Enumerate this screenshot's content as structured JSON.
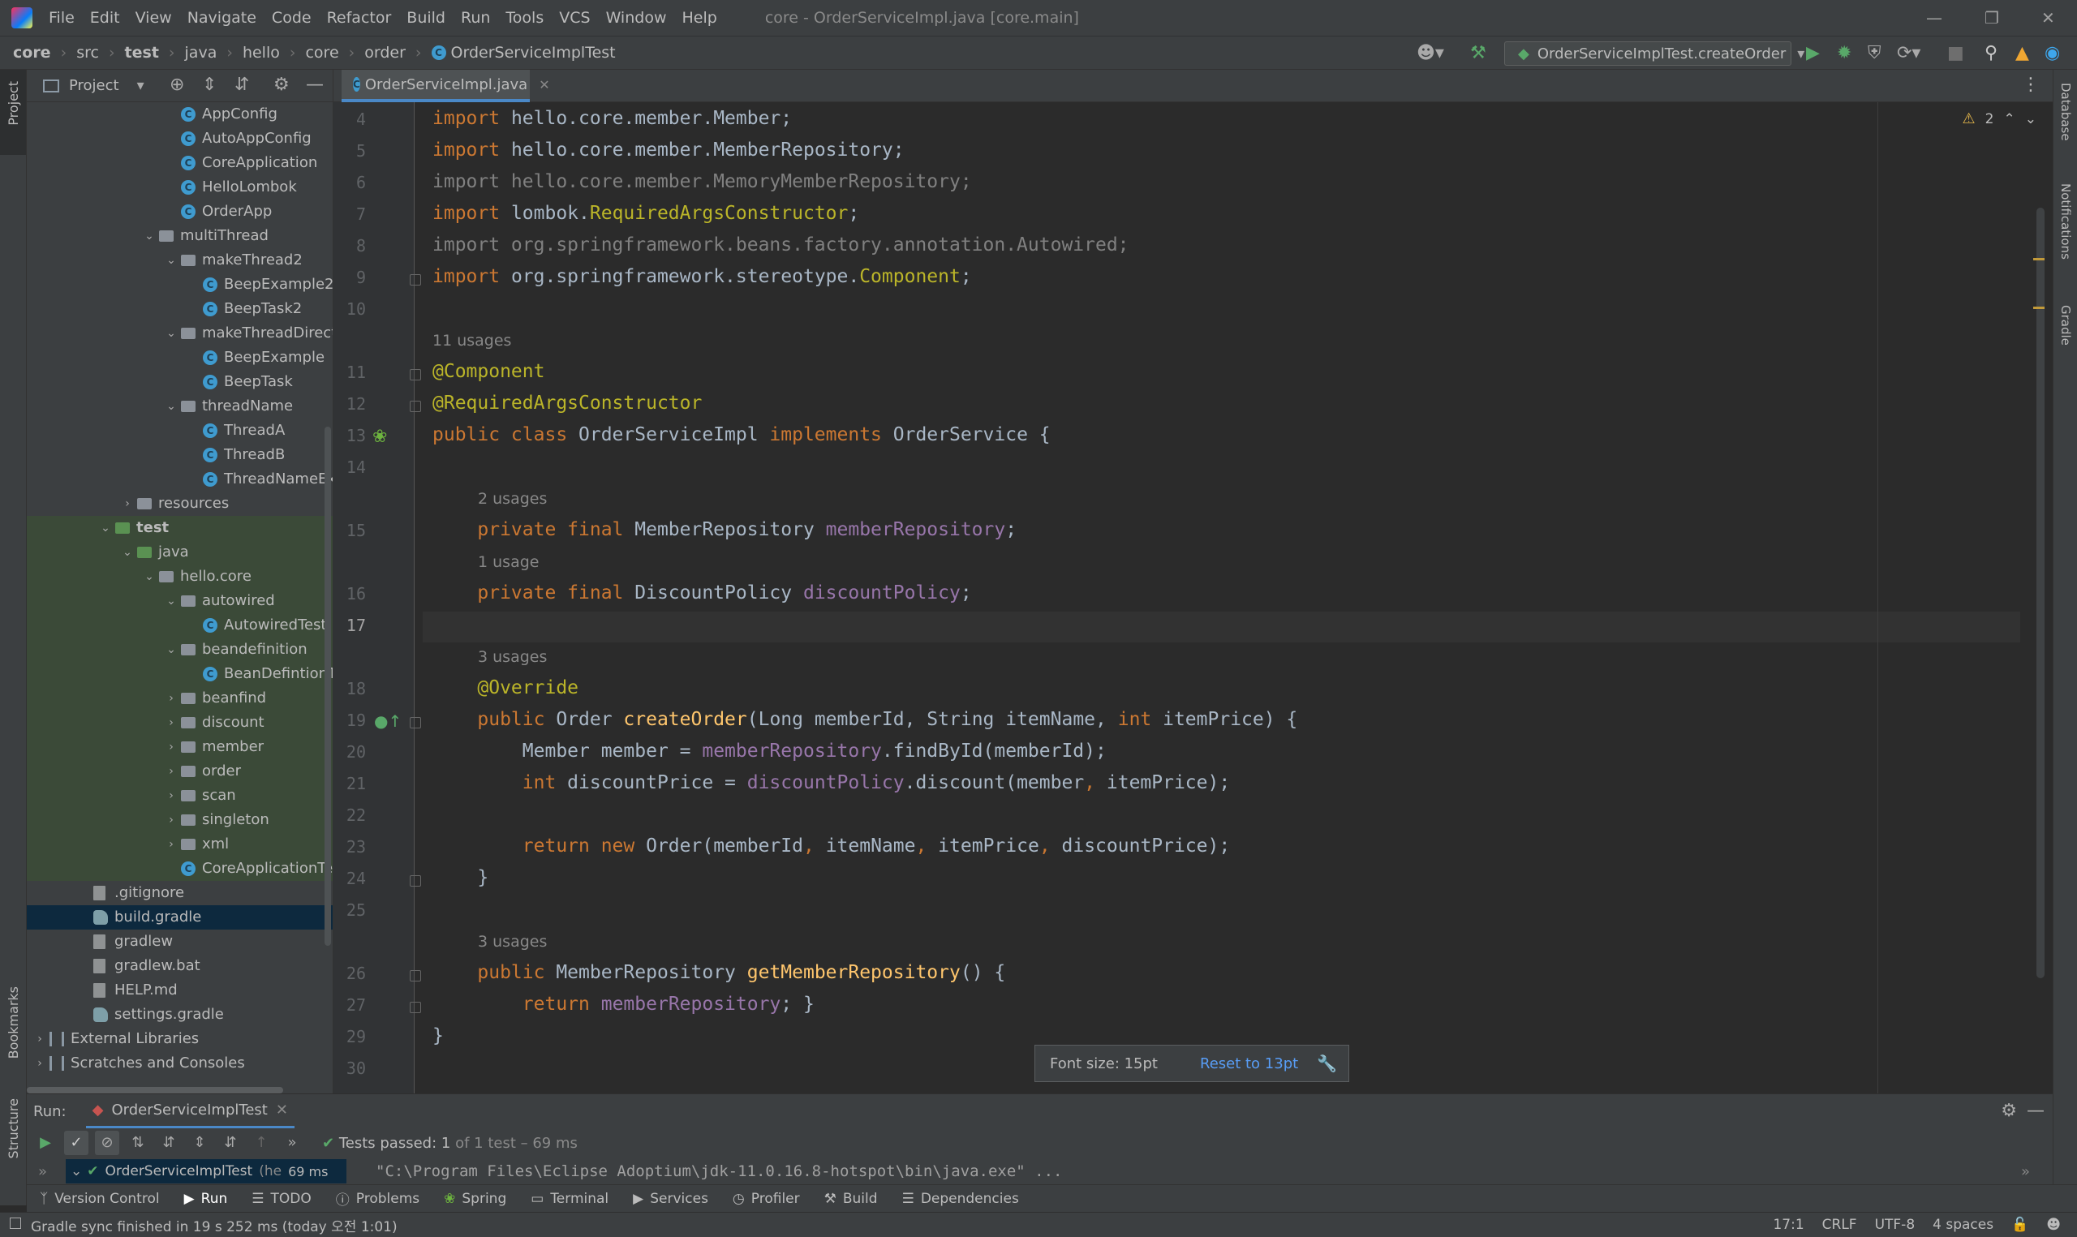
{
  "menubar": {
    "items": [
      "File",
      "Edit",
      "View",
      "Navigate",
      "Code",
      "Refactor",
      "Build",
      "Run",
      "Tools",
      "VCS",
      "Window",
      "Help"
    ],
    "window_title": "core - OrderServiceImpl.java [core.main]"
  },
  "breadcrumb": [
    "core",
    "src",
    "test",
    "java",
    "hello",
    "core",
    "order",
    "OrderServiceImplTest"
  ],
  "run_config": {
    "label": "OrderServiceImplTest.createOrder"
  },
  "project_panel": {
    "title": "Project"
  },
  "tree": [
    {
      "label": "AppConfig",
      "indent": 6,
      "icon": "cls"
    },
    {
      "label": "AutoAppConfig",
      "indent": 6,
      "icon": "cls"
    },
    {
      "label": "CoreApplication",
      "indent": 6,
      "icon": "cls"
    },
    {
      "label": "HelloLombok",
      "indent": 6,
      "icon": "cls"
    },
    {
      "label": "OrderApp",
      "indent": 6,
      "icon": "cls"
    },
    {
      "label": "multiThread",
      "indent": 5,
      "icon": "folder",
      "chev": "open"
    },
    {
      "label": "makeThread2",
      "indent": 6,
      "icon": "folder",
      "chev": "open"
    },
    {
      "label": "BeepExample2",
      "indent": 7,
      "icon": "cls"
    },
    {
      "label": "BeepTask2",
      "indent": 7,
      "icon": "cls"
    },
    {
      "label": "makeThreadDirectly",
      "indent": 6,
      "icon": "folder",
      "chev": "open"
    },
    {
      "label": "BeepExample",
      "indent": 7,
      "icon": "cls"
    },
    {
      "label": "BeepTask",
      "indent": 7,
      "icon": "cls"
    },
    {
      "label": "threadName",
      "indent": 6,
      "icon": "folder",
      "chev": "open"
    },
    {
      "label": "ThreadA",
      "indent": 7,
      "icon": "cls"
    },
    {
      "label": "ThreadB",
      "indent": 7,
      "icon": "cls"
    },
    {
      "label": "ThreadNameExam",
      "indent": 7,
      "icon": "cls"
    },
    {
      "label": "resources",
      "indent": 4,
      "icon": "folder-res",
      "chev": "closed"
    },
    {
      "label": "test",
      "indent": 3,
      "icon": "folder-green",
      "chev": "open",
      "bold": true,
      "green": true
    },
    {
      "label": "java",
      "indent": 4,
      "icon": "folder-green",
      "chev": "open",
      "green": true
    },
    {
      "label": "hello.core",
      "indent": 5,
      "icon": "folder",
      "chev": "open",
      "green": true
    },
    {
      "label": "autowired",
      "indent": 6,
      "icon": "folder",
      "chev": "open",
      "green": true
    },
    {
      "label": "AutowiredTest",
      "indent": 7,
      "icon": "cls",
      "green": true
    },
    {
      "label": "beandefinition",
      "indent": 6,
      "icon": "folder",
      "chev": "open",
      "green": true
    },
    {
      "label": "BeanDefintionTest",
      "indent": 7,
      "icon": "cls",
      "green": true
    },
    {
      "label": "beanfind",
      "indent": 6,
      "icon": "folder",
      "chev": "closed",
      "green": true
    },
    {
      "label": "discount",
      "indent": 6,
      "icon": "folder",
      "chev": "closed",
      "green": true
    },
    {
      "label": "member",
      "indent": 6,
      "icon": "folder",
      "chev": "closed",
      "green": true
    },
    {
      "label": "order",
      "indent": 6,
      "icon": "folder",
      "chev": "closed",
      "green": true
    },
    {
      "label": "scan",
      "indent": 6,
      "icon": "folder",
      "chev": "closed",
      "green": true
    },
    {
      "label": "singleton",
      "indent": 6,
      "icon": "folder",
      "chev": "closed",
      "green": true
    },
    {
      "label": "xml",
      "indent": 6,
      "icon": "folder",
      "chev": "closed",
      "green": true
    },
    {
      "label": "CoreApplicationTests",
      "indent": 6,
      "icon": "cls",
      "green": true
    },
    {
      "label": ".gitignore",
      "indent": 2,
      "icon": "file"
    },
    {
      "label": "build.gradle",
      "indent": 2,
      "icon": "gradle",
      "selected": true
    },
    {
      "label": "gradlew",
      "indent": 2,
      "icon": "file"
    },
    {
      "label": "gradlew.bat",
      "indent": 2,
      "icon": "file"
    },
    {
      "label": "HELP.md",
      "indent": 2,
      "icon": "file"
    },
    {
      "label": "settings.gradle",
      "indent": 2,
      "icon": "gradle"
    },
    {
      "label": "External Libraries",
      "indent": 0,
      "icon": "lib",
      "chev": "closed"
    },
    {
      "label": "Scratches and Consoles",
      "indent": 0,
      "icon": "lib",
      "chev": "closed"
    }
  ],
  "editor": {
    "tab_label": "OrderServiceImpl.java",
    "inspection_count": "2",
    "lines": [
      {
        "n": "4",
        "html": "<span class='kw'>import</span> hello.core.member.Member;"
      },
      {
        "n": "5",
        "html": "<span class='kw'>import</span> hello.core.member.MemberRepository;"
      },
      {
        "n": "6",
        "html": "<span class='un'>import hello.core.member.MemoryMemberRepository;</span>"
      },
      {
        "n": "7",
        "html": "<span class='kw'>import</span> lombok.<span class='an'>RequiredArgsConstructor</span>;"
      },
      {
        "n": "8",
        "html": "<span class='un'>import org.springframework.beans.factory.annotation.Autowired;</span>"
      },
      {
        "n": "9",
        "html": "<span class='kw'>import</span> org.springframework.stereotype.<span class='an'>Component</span>;"
      },
      {
        "n": "10",
        "html": ""
      },
      {
        "hint": "11 usages"
      },
      {
        "n": "11",
        "html": "<span class='an'>@Component</span>"
      },
      {
        "n": "12",
        "html": "<span class='an'>@RequiredArgsConstructor</span>"
      },
      {
        "n": "13",
        "html": "<span class='kw'>public class</span> OrderServiceImpl <span class='kw'>implements</span> OrderService {"
      },
      {
        "n": "14",
        "html": ""
      },
      {
        "hint": "2 usages",
        "indent": 1
      },
      {
        "n": "15",
        "html": "    <span class='kw'>private final</span> MemberRepository <span class='fld'>memberRepository</span>;"
      },
      {
        "hint": "1 usage",
        "indent": 1
      },
      {
        "n": "16",
        "html": "    <span class='kw'>private final</span> DiscountPolicy <span class='fld'>discountPolicy</span>;"
      },
      {
        "n": "17",
        "html": "",
        "current": true
      },
      {
        "hint": "3 usages",
        "indent": 1
      },
      {
        "n": "18",
        "html": "    <span class='an'>@Override</span>"
      },
      {
        "n": "19",
        "html": "    <span class='kw'>public</span> Order <span class='fn'>createOrder</span>(Long memberId, String itemName, <span class='kw'>int</span> itemPrice) {"
      },
      {
        "n": "20",
        "html": "        Member member = <span class='fld'>memberRepository</span>.findById(memberId);"
      },
      {
        "n": "21",
        "html": "        <span class='kw'>int</span> discountPrice = <span class='fld'>discountPolicy</span>.discount(member<span class='kw'>,</span> itemPrice);"
      },
      {
        "n": "22",
        "html": ""
      },
      {
        "n": "23",
        "html": "        <span class='kw'>return new</span> Order(memberId<span class='kw'>,</span> itemName<span class='kw'>,</span> itemPrice<span class='kw'>,</span> discountPrice);"
      },
      {
        "n": "24",
        "html": "    }"
      },
      {
        "n": "25",
        "html": ""
      },
      {
        "hint": "3 usages",
        "indent": 1
      },
      {
        "n": "26",
        "html": "    <span class='kw'>public</span> MemberRepository <span class='fn'>getMemberRepository</span>() {"
      },
      {
        "n": "27",
        "html": "        <span class='kw'>return</span> <span class='fld'>memberRepository</span>; }"
      },
      {
        "n": "29",
        "html": "}"
      },
      {
        "n": "30",
        "html": ""
      }
    ]
  },
  "tooltip": {
    "font_size": "Font size: 15pt",
    "reset": "Reset to 13pt"
  },
  "run_panel": {
    "label": "Run:",
    "tab": "OrderServiceImplTest",
    "tests_passed": "Tests passed:",
    "tests_count": "1",
    "tests_detail": "of 1 test – 69 ms",
    "tree_item": "OrderServiceImplTest",
    "tree_item_extra": "(he",
    "tree_item_time": "69 ms",
    "console": "\"C:\\Program Files\\Eclipse Adoptium\\jdk-11.0.16.8-hotspot\\bin\\java.exe\" ..."
  },
  "toolwindows": [
    "Version Control",
    "Run",
    "TODO",
    "Problems",
    "Spring",
    "Terminal",
    "Services",
    "Profiler",
    "Build",
    "Dependencies"
  ],
  "status": {
    "message": "Gradle sync finished in 19 s 252 ms (today 오전 1:01)",
    "position": "17:1",
    "line_sep": "CRLF",
    "encoding": "UTF-8",
    "indent": "4 spaces"
  },
  "side_labels": {
    "project": "Project",
    "bookmarks": "Bookmarks",
    "structure": "Structure",
    "database": "Database",
    "notifications": "Notifications",
    "gradle": "Gradle"
  }
}
